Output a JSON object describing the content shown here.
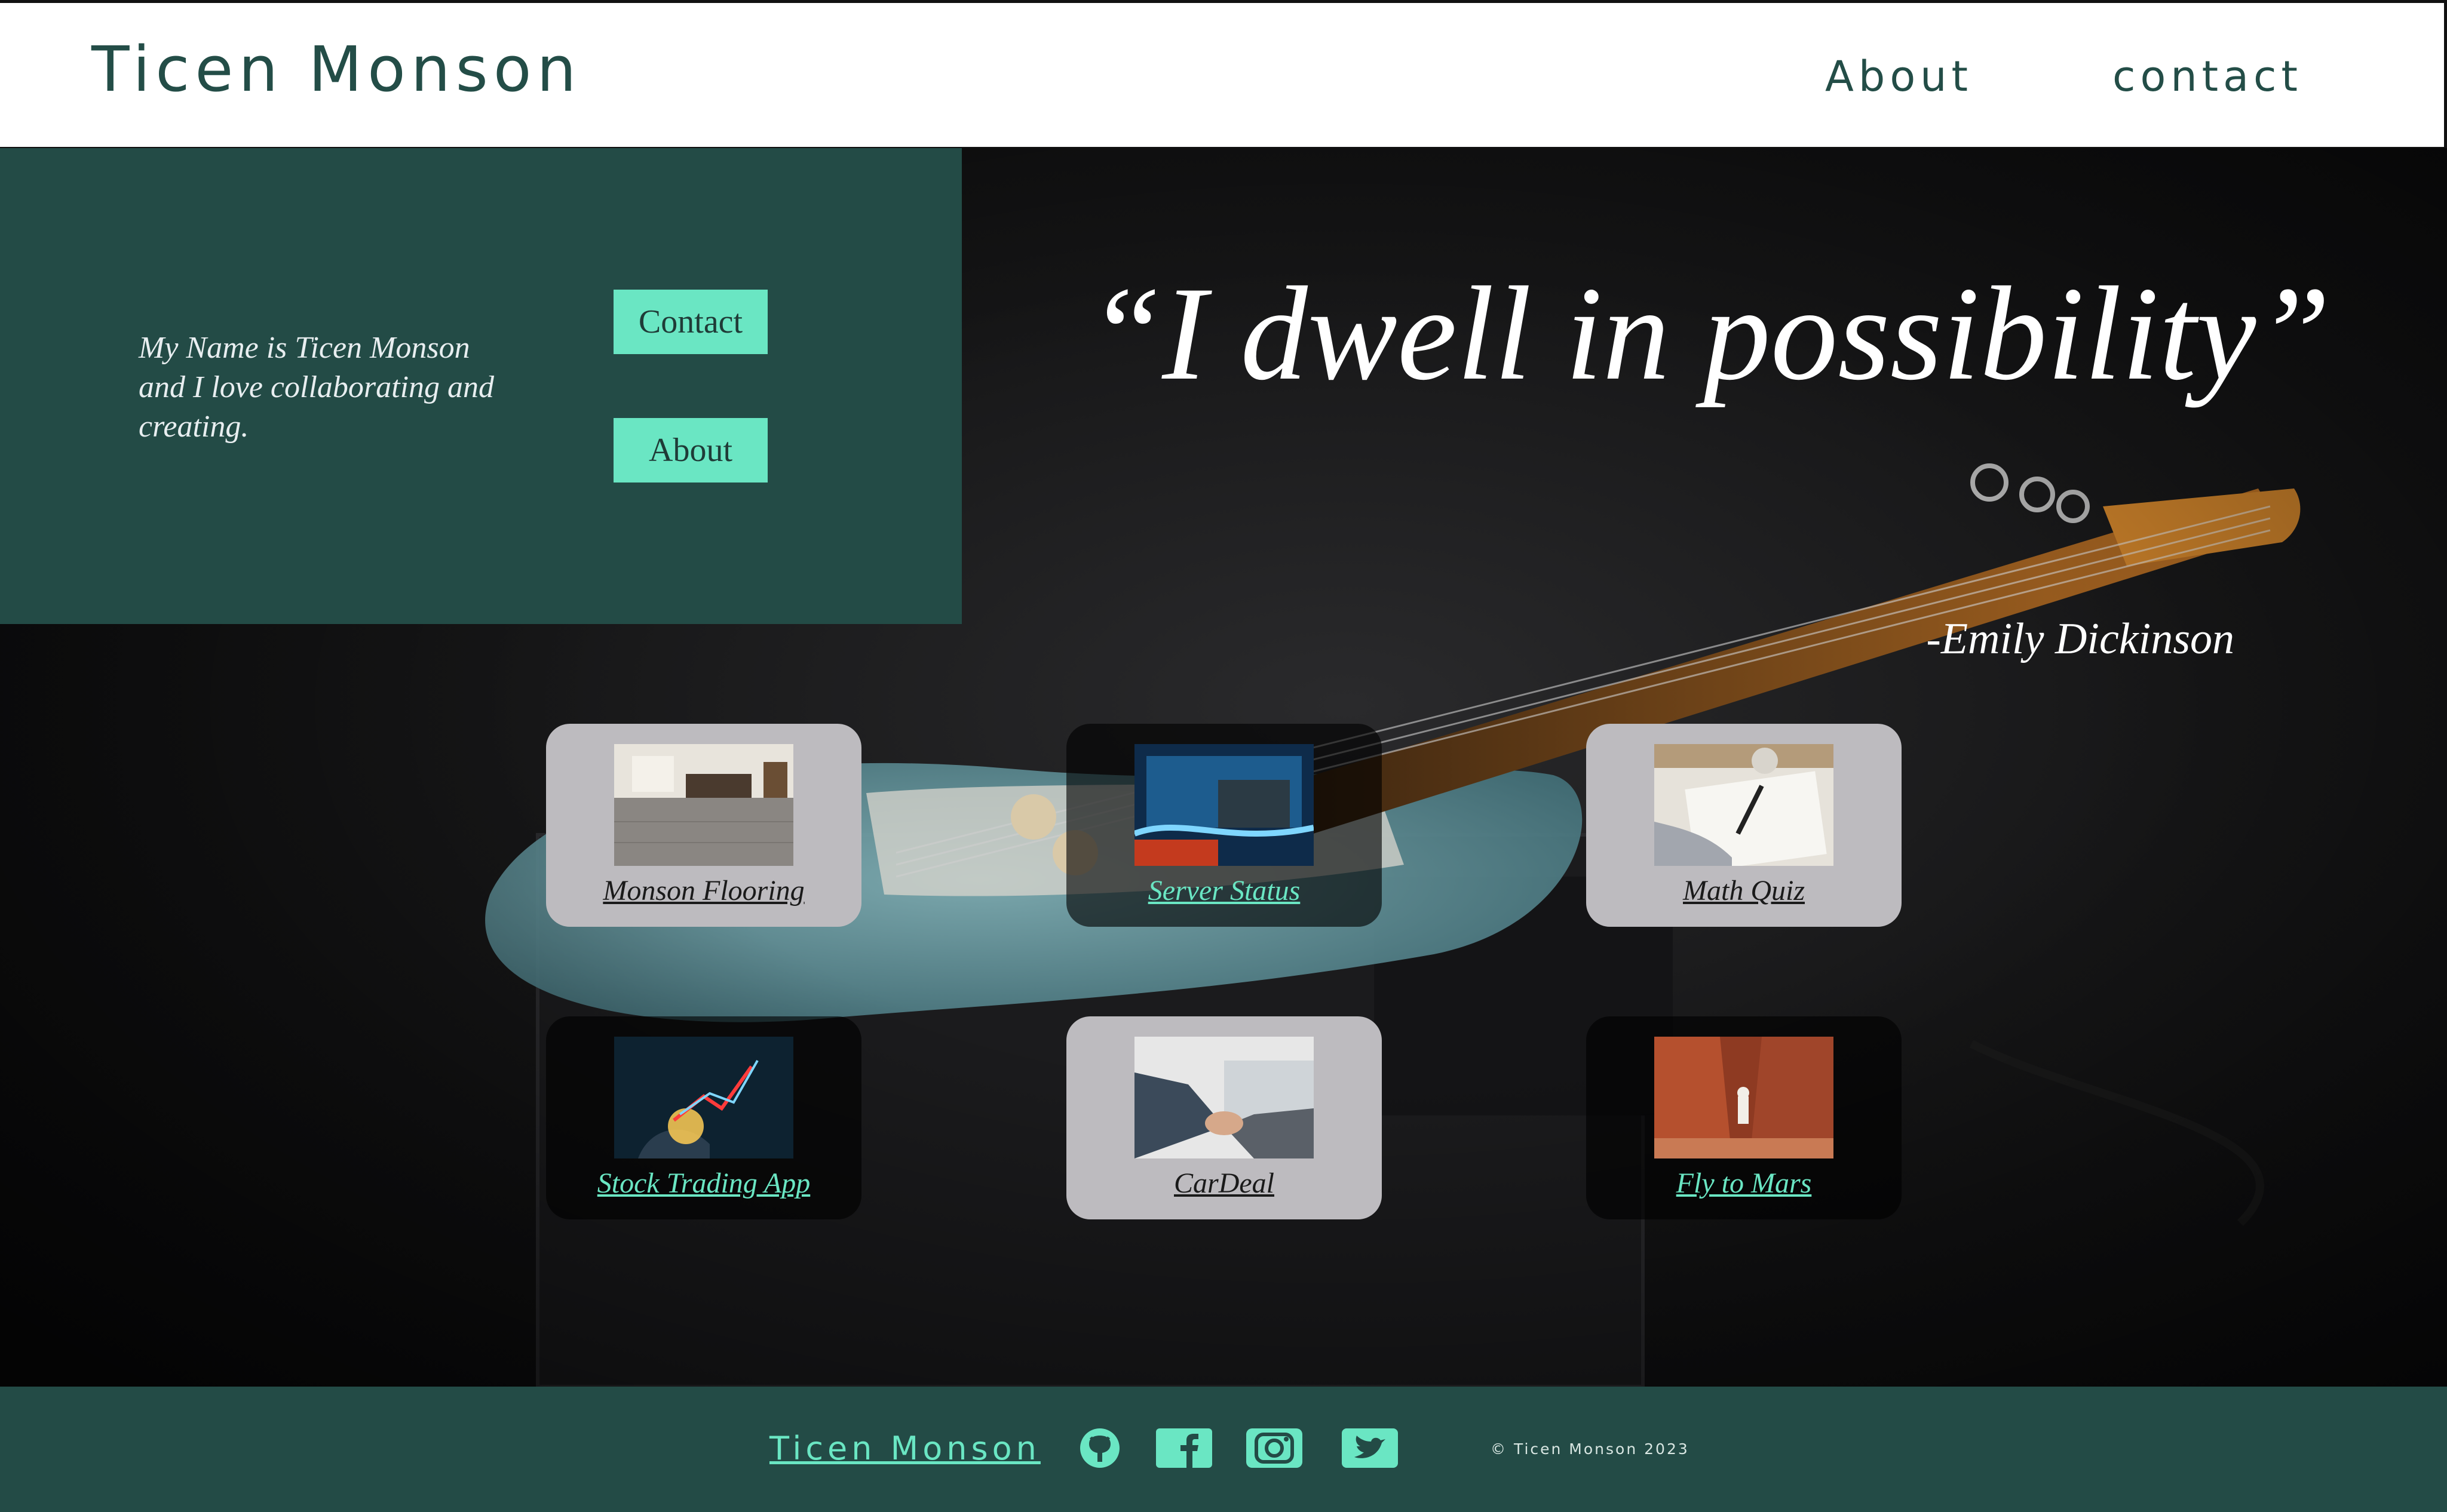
{
  "header": {
    "brand": "Ticen Monson",
    "nav": [
      {
        "label": "About"
      },
      {
        "label": "contact"
      }
    ]
  },
  "hero": {
    "intro": "My Name is Ticen Monson and I love collaborating and creating.",
    "buttons": {
      "contact": "Contact",
      "about": "About"
    },
    "quote": "“I dwell in possibility”",
    "quote_author": "-Emily Dickinson"
  },
  "projects": [
    {
      "label": "Monson Flooring",
      "style": "light",
      "image": "flooring-photo"
    },
    {
      "label": "Server Status",
      "style": "dark",
      "image": "server-hardware-photo"
    },
    {
      "label": "Math Quiz",
      "style": "light",
      "image": "writing-hand-photo"
    },
    {
      "label": "Stock Trading App",
      "style": "dark",
      "image": "stock-chart-photo"
    },
    {
      "label": "CarDeal",
      "style": "light",
      "image": "handshake-photo"
    },
    {
      "label": "Fly to Mars",
      "style": "dark",
      "image": "mars-astronaut-photo"
    }
  ],
  "footer": {
    "brand": "Ticen Monson",
    "social": [
      "github-icon",
      "facebook-icon",
      "instagram-icon",
      "twitter-icon"
    ],
    "copyright": "© Ticen Monson 2023"
  },
  "colors": {
    "primary_dark": "#234b46",
    "accent": "#6ae6c3",
    "card_light": "#bdbbbf"
  }
}
